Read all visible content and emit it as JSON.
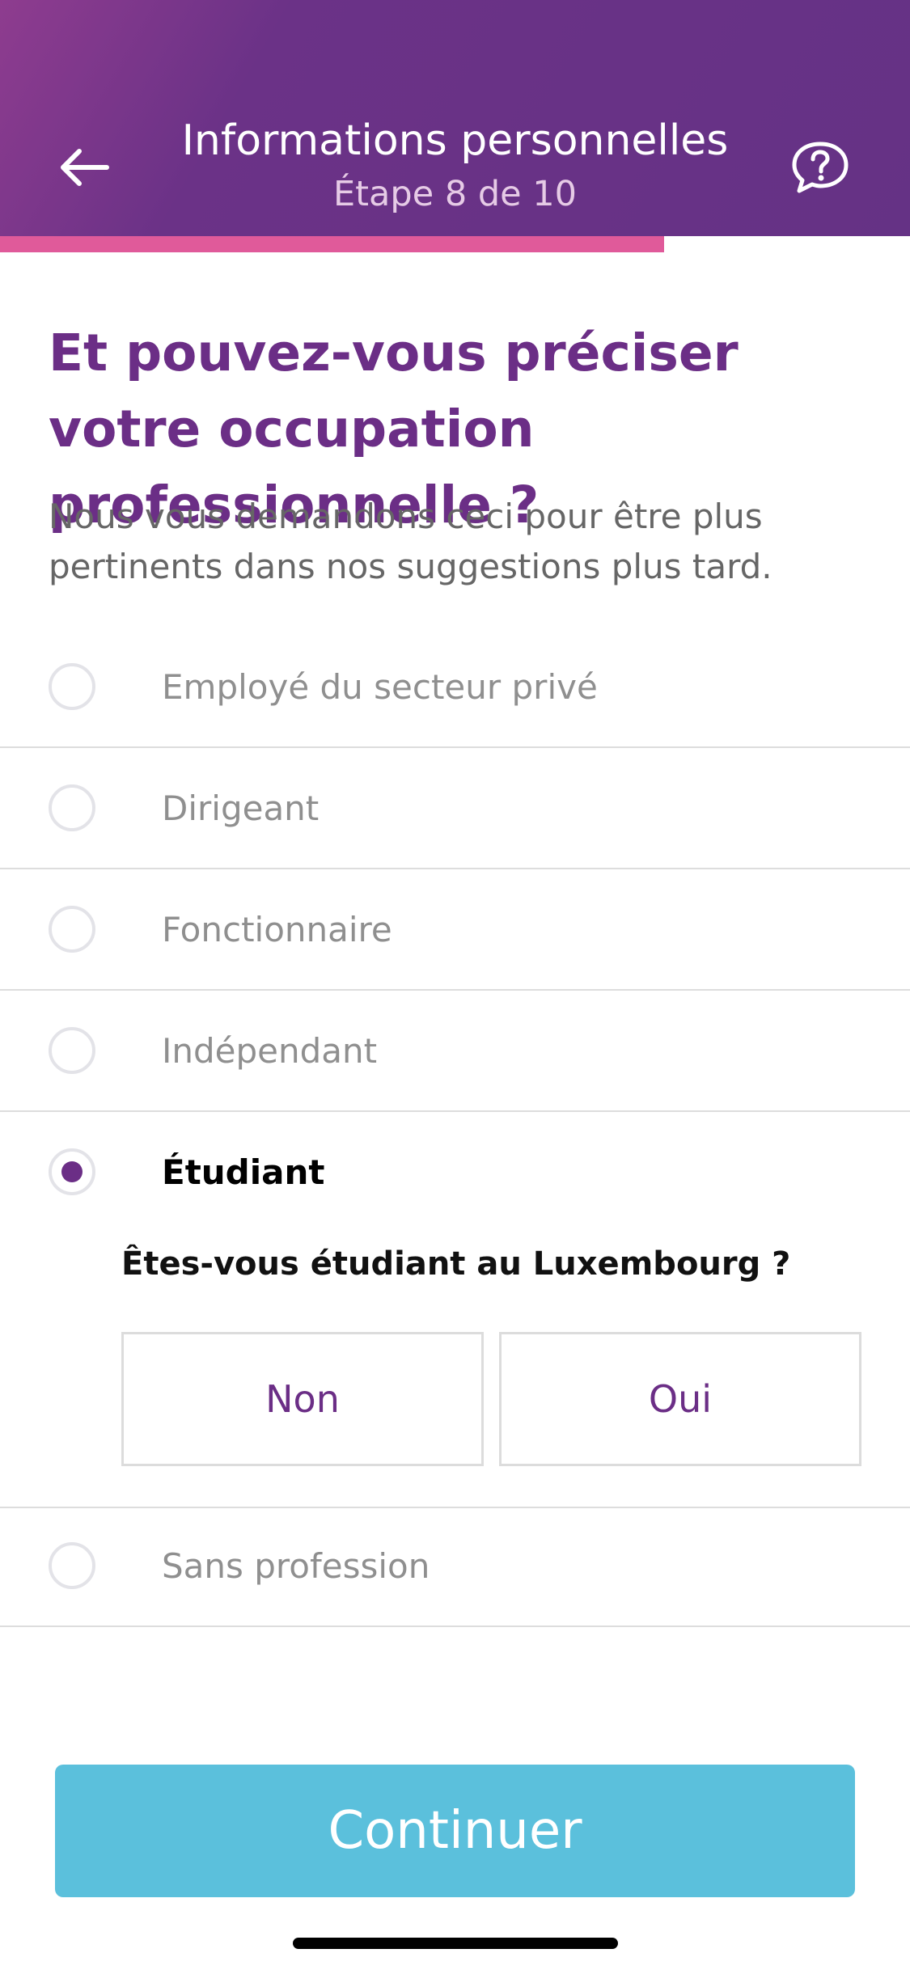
{
  "header": {
    "title": "Informations personnelles",
    "step": "Étape 8 de 10",
    "back_icon": "arrow-left-icon",
    "help_icon": "help-chat-icon",
    "gradient_start": "#8e3c8f",
    "gradient_end": "#653285"
  },
  "progress": {
    "fraction": 0.73,
    "color": "#e05a9a"
  },
  "question": {
    "title": "Et pouvez-vous préciser votre occupation professionnelle ?",
    "subtitle": "Nous vous demandons ceci pour être plus pertinents dans nos suggestions plus tard."
  },
  "options": [
    {
      "label": "Employé du secteur privé",
      "selected": false
    },
    {
      "label": "Dirigeant",
      "selected": false
    },
    {
      "label": "Fonctionnaire",
      "selected": false
    },
    {
      "label": "Indépendant",
      "selected": false
    },
    {
      "label": "Étudiant",
      "selected": true
    },
    {
      "label": "Sans profession",
      "selected": false
    }
  ],
  "student_followup": {
    "question": "Êtes-vous étudiant au Luxembourg ?",
    "no_label": "Non",
    "yes_label": "Oui"
  },
  "footer": {
    "continue_label": "Continuer",
    "button_color": "#5bc0dc"
  },
  "colors": {
    "accent": "#6b2e86"
  }
}
